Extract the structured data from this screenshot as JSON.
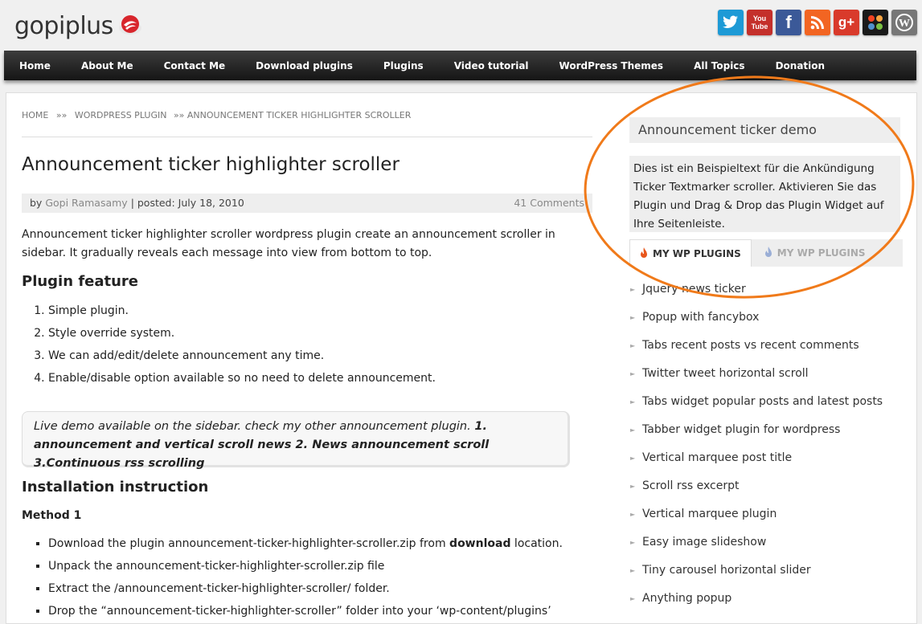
{
  "site": {
    "logo_text": "gopiplus"
  },
  "social_icons": [
    {
      "name": "twitter-icon",
      "glyph": "t",
      "color": "#1d9ad6"
    },
    {
      "name": "youtube-icon",
      "glyph": "You Tube",
      "color": "#c4302b"
    },
    {
      "name": "facebook-icon",
      "glyph": "f",
      "color": "#3b5998"
    },
    {
      "name": "rss-icon",
      "glyph": "◉",
      "color": "#f26522"
    },
    {
      "name": "google-plus-icon",
      "glyph": "g+",
      "color": "#d93a2b"
    },
    {
      "name": "joomla-icon",
      "glyph": "✻",
      "color": "#1a1a1a"
    },
    {
      "name": "wordpress-icon",
      "glyph": "W",
      "color": "#777777"
    }
  ],
  "nav": [
    "Home",
    "About Me",
    "Contact Me",
    "Download plugins",
    "Plugins",
    "Video tutorial",
    "WordPress Themes",
    "All Topics",
    "Donation"
  ],
  "breadcrumb": {
    "home": "HOME",
    "sep": "»»",
    "section": "WORDPRESS PLUGIN",
    "current": "»» ANNOUNCEMENT TICKER HIGHLIGHTER SCROLLER"
  },
  "post": {
    "title": "Announcement ticker highlighter scroller",
    "by": "by",
    "author": "Gopi Ramasamy",
    "posted": "| posted: July 18, 2010",
    "comments": "41 Comments",
    "intro": "Announcement ticker highlighter scroller wordpress plugin create an announcement scroller in sidebar. It gradually reveals each message into view from bottom to top.",
    "feature_heading": "Plugin feature",
    "features": [
      "Simple plugin.",
      "Style override system.",
      "We can add/edit/delete announcement any time.",
      "Enable/disable option available so no need to delete announcement."
    ],
    "demo_note_plain": "Live demo available on the sidebar. check my other announcement plugin. ",
    "demo_note_bold": "1. announcement and vertical scroll news 2. News announcement scroll 3.Continuous rss scrolling",
    "install_heading": "Installation instruction",
    "method": "Method 1",
    "install_steps": [
      {
        "pre": "Download the plugin announcement-ticker-highlighter-scroller.zip from ",
        "bold": "download",
        "post": " location."
      },
      {
        "pre": "Unpack the announcement-ticker-highlighter-scroller.zip file",
        "bold": "",
        "post": ""
      },
      {
        "pre": "Extract the /announcement-ticker-highlighter-scroller/ folder.",
        "bold": "",
        "post": ""
      },
      {
        "pre": "Drop the “announcement-ticker-highlighter-scroller” folder into your ‘wp-content/plugins’",
        "bold": "",
        "post": ""
      }
    ]
  },
  "sidebar": {
    "widget_title": "Announcement ticker demo",
    "widget_text": "Dies ist ein Beispieltext für die Ankündigung Ticker Textmarker scroller. Aktivieren Sie das Plugin und Drag & Drop das Plugin Widget auf Ihre Seitenleiste.",
    "tab_active": "MY WP PLUGINS",
    "tab_inactive": "MY WP PLUGINS",
    "plugins": [
      "Jquery news ticker",
      "Popup with fancybox",
      "Tabs recent posts vs recent comments",
      "Twitter tweet horizontal scroll",
      "Tabs widget popular posts and latest posts",
      "Tabber widget plugin for wordpress",
      "Vertical marquee post title",
      "Scroll rss excerpt",
      "Vertical marquee plugin",
      "Easy image slideshow",
      "Tiny carousel horizontal slider",
      "Anything popup"
    ]
  },
  "colors": {
    "annotation_oval": "#f07a1a",
    "accent_flame": "#e8561c"
  }
}
